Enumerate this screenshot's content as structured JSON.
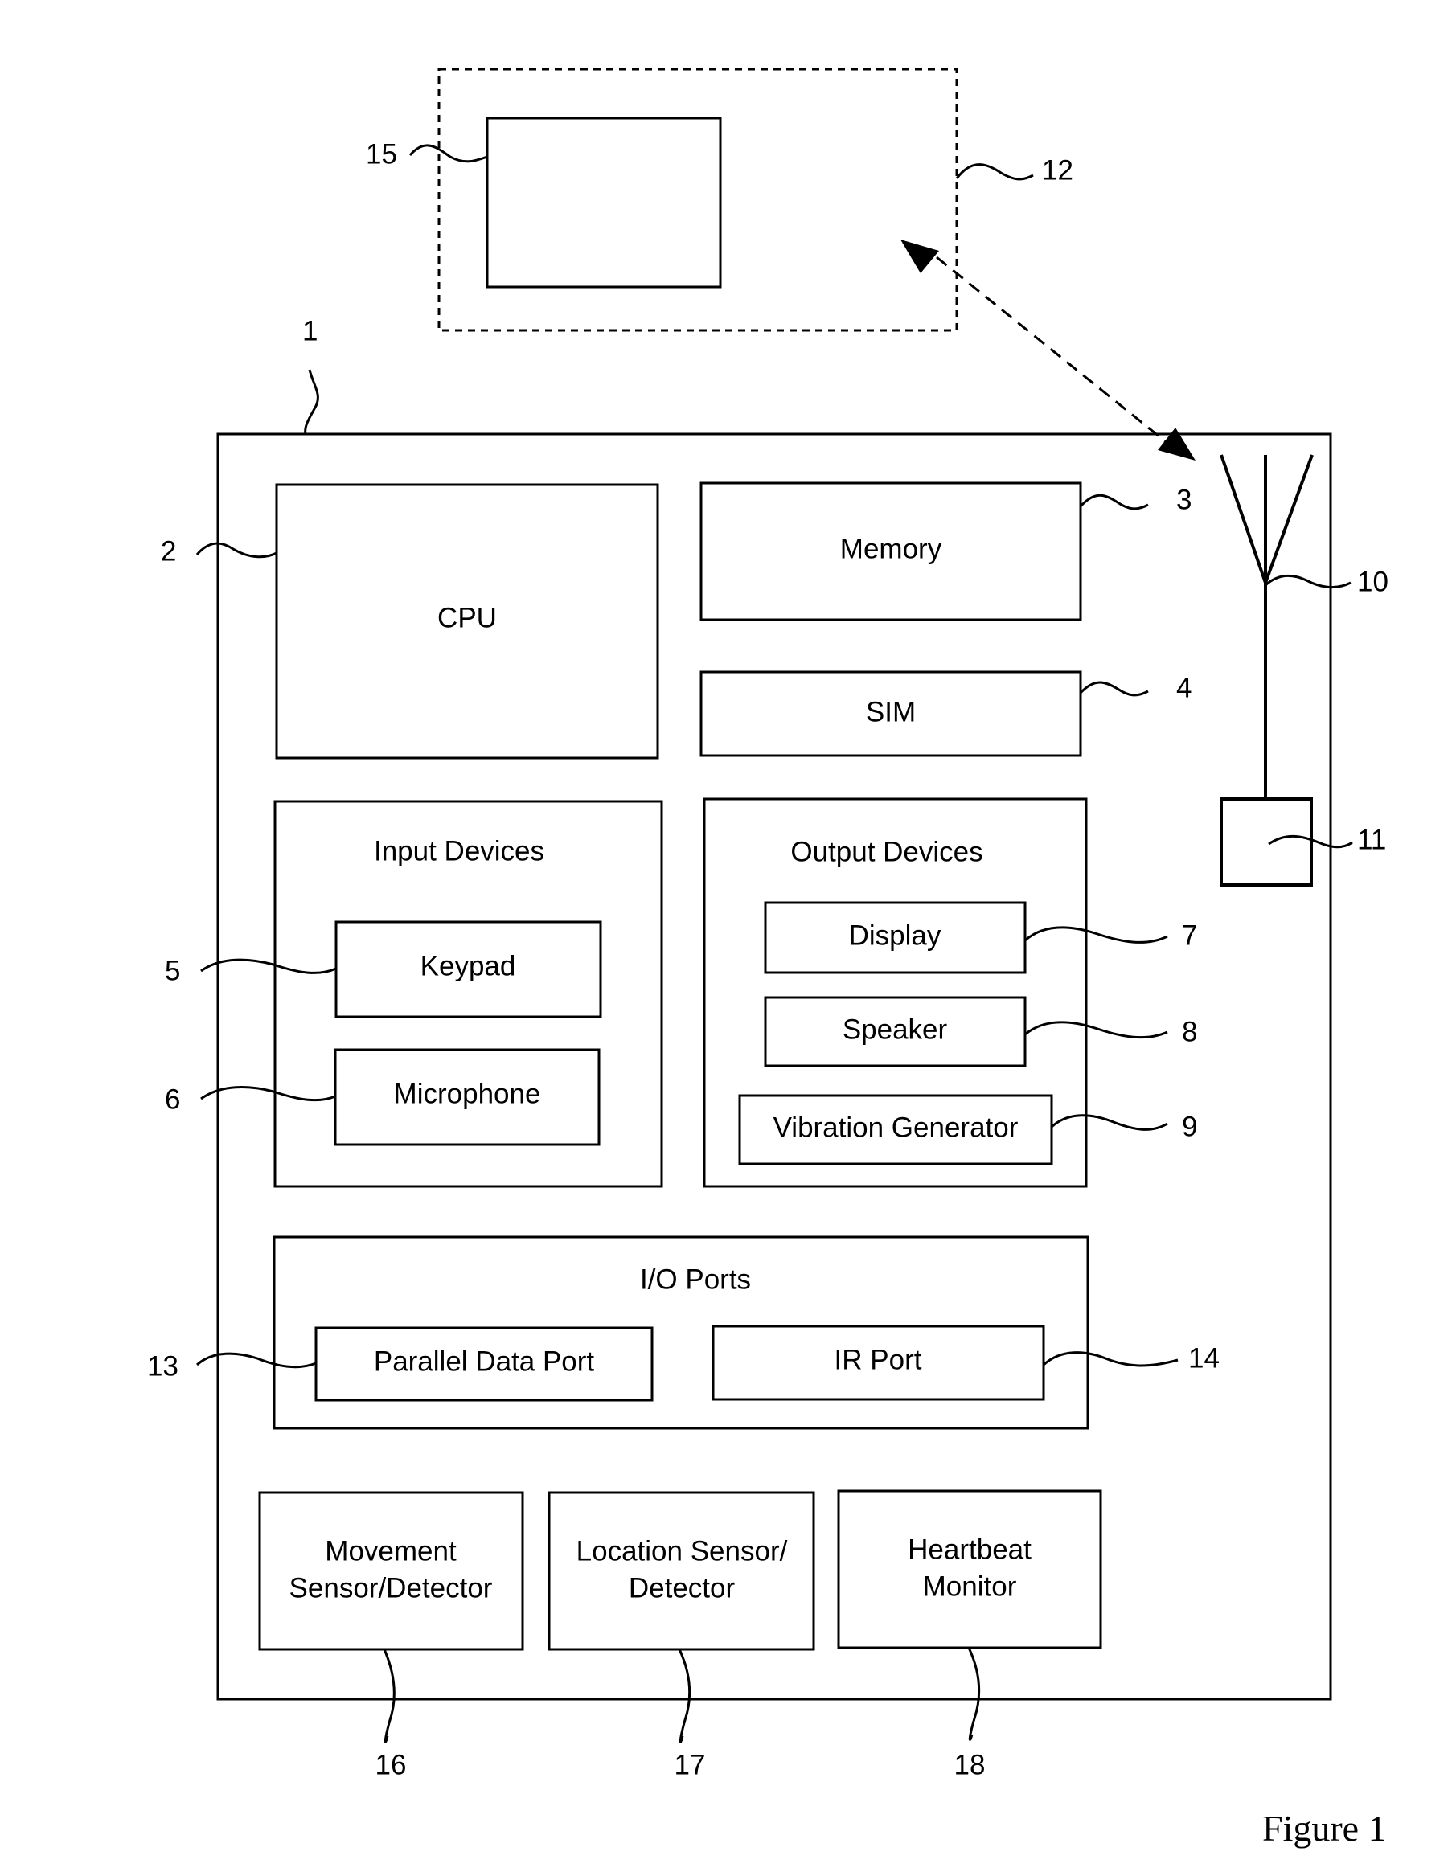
{
  "figure": {
    "caption": "Figure 1"
  },
  "external_device": {
    "ref": "12",
    "inner_ref": "15"
  },
  "device": {
    "ref": "1",
    "cpu": {
      "label": "CPU",
      "ref": "2"
    },
    "memory": {
      "label": "Memory",
      "ref": "3"
    },
    "sim": {
      "label": "SIM",
      "ref": "4"
    },
    "input_devices": {
      "title": "Input Devices",
      "keypad": {
        "label": "Keypad",
        "ref": "5"
      },
      "microphone": {
        "label": "Microphone",
        "ref": "6"
      }
    },
    "output_devices": {
      "title": "Output Devices",
      "display": {
        "label": "Display",
        "ref": "7"
      },
      "speaker": {
        "label": "Speaker",
        "ref": "8"
      },
      "vibration": {
        "label": "Vibration Generator",
        "ref": "9"
      }
    },
    "antenna": {
      "ref": "10"
    },
    "transceiver": {
      "ref": "11"
    },
    "io_ports": {
      "title": "I/O Ports",
      "parallel": {
        "label": "Parallel Data Port",
        "ref": "13"
      },
      "ir": {
        "label": "IR Port",
        "ref": "14"
      }
    },
    "movement_sensor": {
      "line1": "Movement",
      "line2": "Sensor/Detector",
      "ref": "16"
    },
    "location_sensor": {
      "line1": "Location Sensor/",
      "line2": "Detector",
      "ref": "17"
    },
    "heartbeat_monitor": {
      "line1": "Heartbeat",
      "line2": "Monitor",
      "ref": "18"
    }
  }
}
